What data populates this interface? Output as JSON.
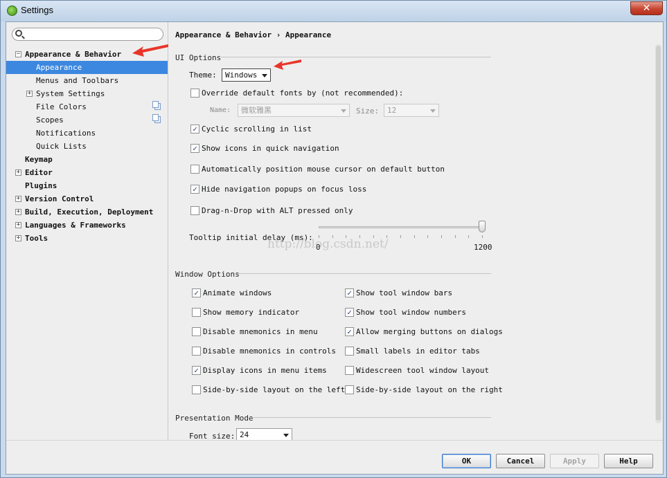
{
  "window": {
    "title": "Settings",
    "close_glyph": "✕"
  },
  "colors": {
    "selection": "#3c88e0",
    "arrow": "#e8352a"
  },
  "sidebar": {
    "search_placeholder": "",
    "items": [
      {
        "label": "Appearance & Behavior",
        "expander": "−",
        "bold": true
      },
      {
        "label": "Appearance",
        "selected": true
      },
      {
        "label": "Menus and Toolbars"
      },
      {
        "label": "System Settings",
        "expander": "+"
      },
      {
        "label": "File Colors",
        "icon": "copy-icon"
      },
      {
        "label": "Scopes",
        "icon": "copy-icon"
      },
      {
        "label": "Notifications"
      },
      {
        "label": "Quick Lists"
      },
      {
        "label": "Keymap",
        "bold": true
      },
      {
        "label": "Editor",
        "expander": "+",
        "bold": true
      },
      {
        "label": "Plugins",
        "bold": true
      },
      {
        "label": "Version Control",
        "expander": "+",
        "bold": true
      },
      {
        "label": "Build, Execution, Deployment",
        "expander": "+",
        "bold": true
      },
      {
        "label": "Languages & Frameworks",
        "expander": "+",
        "bold": true
      },
      {
        "label": "Tools",
        "expander": "+",
        "bold": true
      }
    ]
  },
  "main": {
    "breadcrumb": {
      "parent": "Appearance & Behavior",
      "sep": "›",
      "current": "Appearance"
    },
    "ui_options": {
      "title": "UI Options",
      "theme_label": "Theme:",
      "theme_value": "Windows",
      "override_fonts": {
        "label": "Override default fonts by (not recommended):",
        "checked": false
      },
      "name_label": "Name:",
      "name_value": "微软雅黑",
      "size_label": "Size:",
      "size_value": "12",
      "checkboxes": [
        {
          "label": "Cyclic scrolling in list",
          "checked": true
        },
        {
          "label": "Show icons in quick navigation",
          "checked": true
        },
        {
          "label": "Automatically position mouse cursor on default button",
          "checked": false
        },
        {
          "label": "Hide navigation popups on focus loss",
          "checked": true
        },
        {
          "label": "Drag-n-Drop with ALT pressed only",
          "checked": false
        }
      ],
      "tooltip_label": "Tooltip initial delay (ms):",
      "tooltip_min": "0",
      "tooltip_max": "1200",
      "tooltip_level": 1.0
    },
    "watermark": "http://blog.csdn.net/",
    "window_options": {
      "title": "Window Options",
      "left": [
        {
          "label": "Animate windows",
          "checked": true
        },
        {
          "label": "Show memory indicator",
          "checked": false
        },
        {
          "label": "Disable mnemonics in menu",
          "checked": false
        },
        {
          "label": "Disable mnemonics in controls",
          "checked": false
        },
        {
          "label": "Display icons in menu items",
          "checked": true
        },
        {
          "label": "Side-by-side layout on the left",
          "checked": false
        }
      ],
      "right": [
        {
          "label": "Show tool window bars",
          "checked": true
        },
        {
          "label": "Show tool window numbers",
          "checked": true
        },
        {
          "label": "Allow merging buttons on dialogs",
          "checked": true
        },
        {
          "label": "Small labels in editor tabs",
          "checked": false
        },
        {
          "label": "Widescreen tool window layout",
          "checked": false
        },
        {
          "label": "Side-by-side layout on the right",
          "checked": false
        }
      ]
    },
    "presentation_mode": {
      "title": "Presentation Mode",
      "font_size_label": "Font size:",
      "font_size_value": "24"
    }
  },
  "footer": {
    "ok": "OK",
    "cancel": "Cancel",
    "apply": "Apply",
    "help": "Help"
  }
}
